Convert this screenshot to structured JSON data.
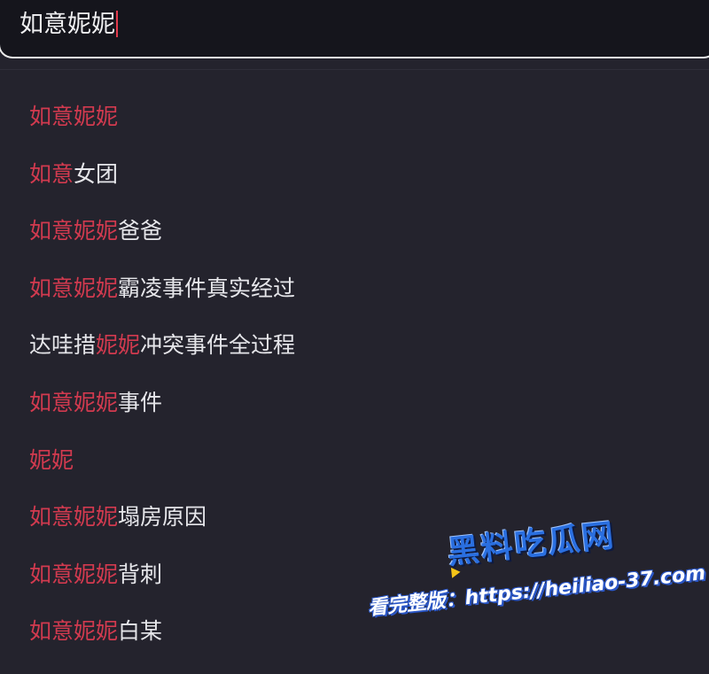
{
  "search": {
    "query": "如意妮妮"
  },
  "suggestions": [
    [
      {
        "text": "如意妮妮",
        "hl": true
      }
    ],
    [
      {
        "text": "如意",
        "hl": true
      },
      {
        "text": "女团",
        "hl": false
      }
    ],
    [
      {
        "text": "如意妮妮",
        "hl": true
      },
      {
        "text": "爸爸",
        "hl": false
      }
    ],
    [
      {
        "text": "如意妮妮",
        "hl": true
      },
      {
        "text": "霸凌事件真实经过",
        "hl": false
      }
    ],
    [
      {
        "text": "达哇措",
        "hl": false
      },
      {
        "text": "妮妮",
        "hl": true
      },
      {
        "text": "冲突事件全过程",
        "hl": false
      }
    ],
    [
      {
        "text": "如意妮妮",
        "hl": true
      },
      {
        "text": "事件",
        "hl": false
      }
    ],
    [
      {
        "text": "妮妮",
        "hl": true
      }
    ],
    [
      {
        "text": "如意妮妮",
        "hl": true
      },
      {
        "text": "塌房原因",
        "hl": false
      }
    ],
    [
      {
        "text": "如意妮妮",
        "hl": true
      },
      {
        "text": "背刺",
        "hl": false
      }
    ],
    [
      {
        "text": "如意妮妮",
        "hl": true
      },
      {
        "text": "白某",
        "hl": false
      }
    ]
  ],
  "colors": {
    "background": "#24232d",
    "search_bar": "#15151c",
    "highlight": "#d23a4f",
    "text": "#e6e6ea",
    "caret": "#e23a4c",
    "watermark_blue": "#2a6fe0"
  },
  "watermark": {
    "logo": "黑料吃瓜网",
    "text": "看完整版：https://heiliao-37.com"
  }
}
